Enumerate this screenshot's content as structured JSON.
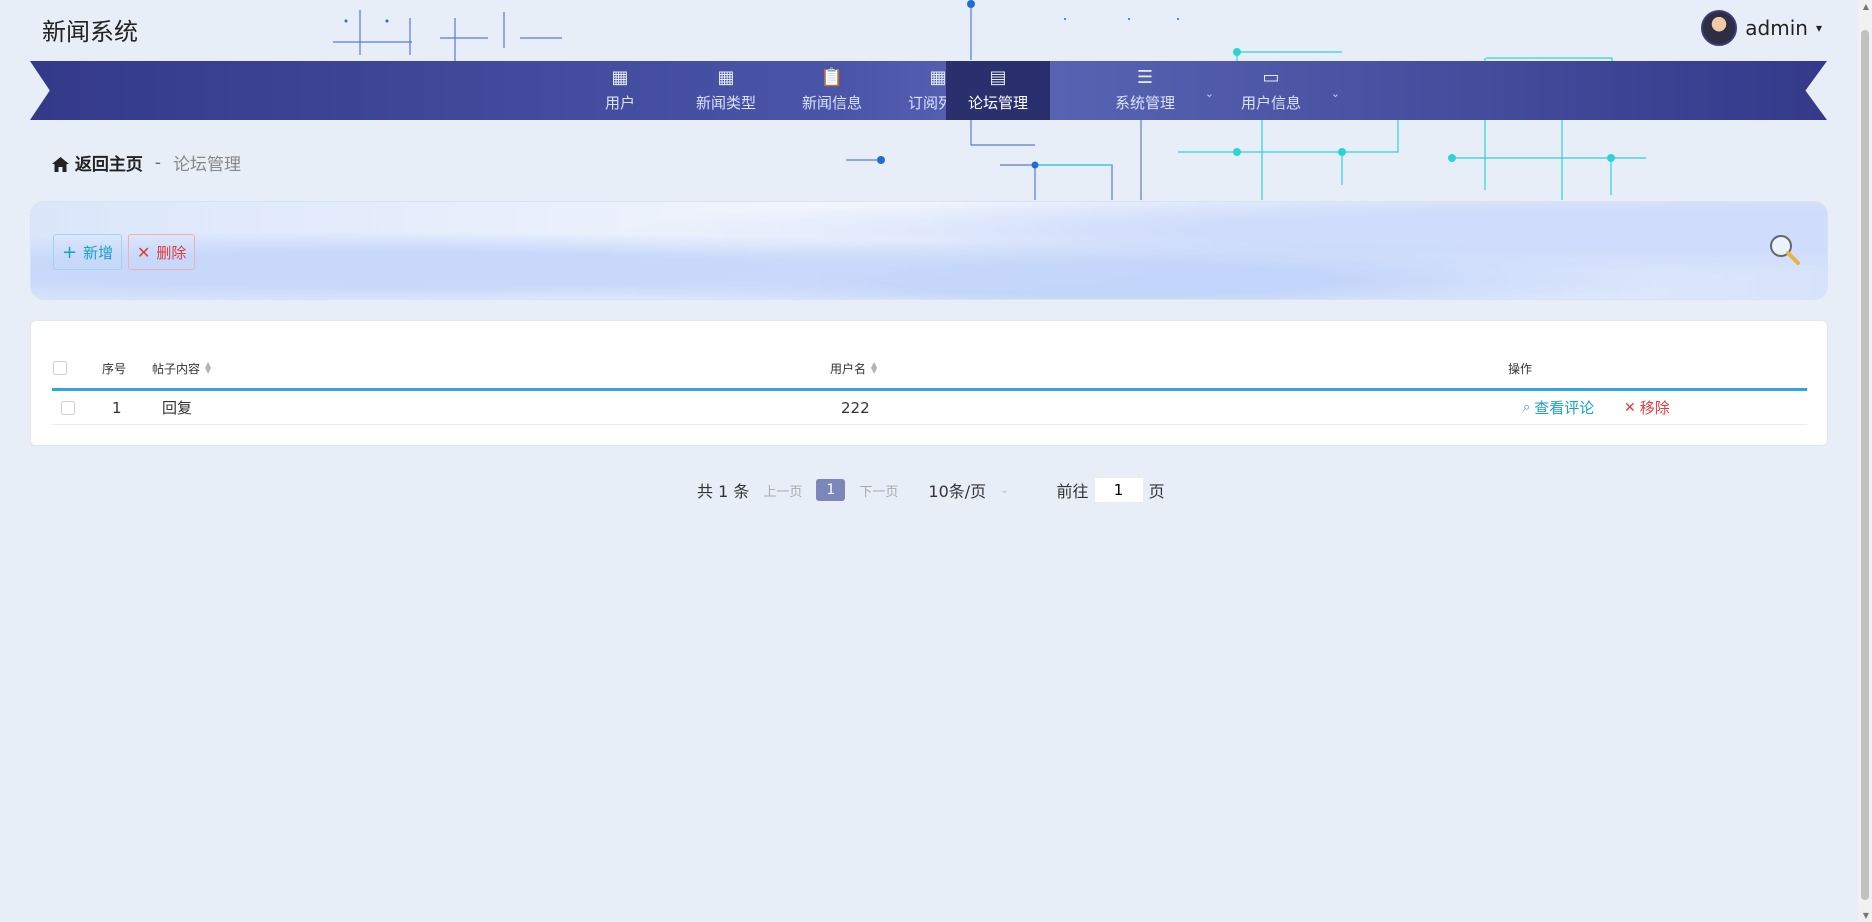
{
  "app": {
    "title": "新闻系统"
  },
  "user": {
    "name": "admin",
    "caret": "▾"
  },
  "nav": {
    "items": [
      {
        "label": "用户",
        "icon": "▦",
        "icon_name": "grid-icon"
      },
      {
        "label": "新闻类型",
        "icon": "▦",
        "icon_name": "grid-icon"
      },
      {
        "label": "新闻信息",
        "icon": "📋",
        "icon_name": "clipboard-icon"
      },
      {
        "label": "订阅列表",
        "icon": "▦",
        "icon_name": "grid-icon"
      },
      {
        "label": "论坛管理",
        "icon": "▤",
        "icon_name": "inbox-icon",
        "active": true
      },
      {
        "label": "系统管理",
        "icon": "☰",
        "icon_name": "menu-icon",
        "dropdown": "⌄"
      },
      {
        "label": "用户信息",
        "icon": "▭",
        "icon_name": "card-icon",
        "dropdown": "⌄"
      }
    ]
  },
  "breadcrumb": {
    "home": "返回主页",
    "separator": "-",
    "current": "论坛管理"
  },
  "toolbar": {
    "add_label": "新增",
    "delete_label": "删除",
    "add_icon": "+",
    "delete_icon": "✕"
  },
  "table": {
    "headers": {
      "index": "序号",
      "content": "帖子内容",
      "username": "用户名",
      "actions": "操作"
    },
    "rows": [
      {
        "index": "1",
        "content": "回复",
        "username": "222",
        "view_label": "查看评论",
        "remove_label": "移除"
      }
    ]
  },
  "pagination": {
    "total": "共 1 条",
    "prev": "上一页",
    "current_page": "1",
    "next": "下一页",
    "page_size": "10条/页",
    "goto_label": "前往",
    "goto_value": "1",
    "goto_suffix": "页"
  },
  "colors": {
    "nav": "#3d4595",
    "accent": "#2ea6df",
    "danger": "#e03c3c",
    "link": "#1ba2cc"
  }
}
